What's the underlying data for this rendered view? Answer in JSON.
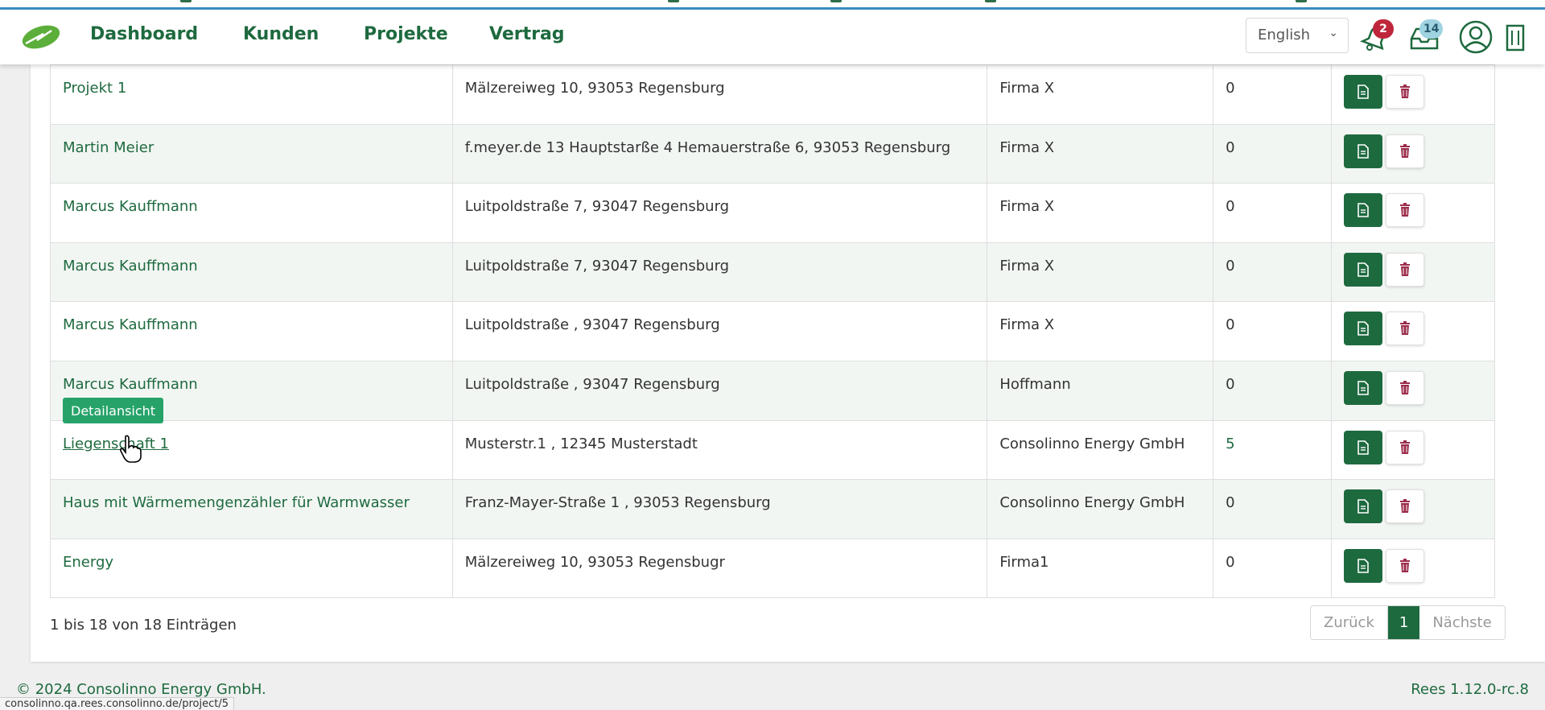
{
  "header": {
    "nav": [
      {
        "label": "Dashboard"
      },
      {
        "label": "Kunden"
      },
      {
        "label": "Projekte"
      },
      {
        "label": "Vertrag"
      }
    ],
    "language": "English",
    "notifications_count": "2",
    "messages_count": "14"
  },
  "table": {
    "rows": [
      {
        "name": "Projekt 1",
        "address": "Mälzereiweg 10, 93053 Regensburg",
        "company": "Firma X",
        "count": "0"
      },
      {
        "name": "Martin Meier",
        "address": "f.meyer.de 13 Hauptstarße 4 Hemauerstraße 6, 93053 Regensburg",
        "company": "Firma X",
        "count": "0"
      },
      {
        "name": "Marcus Kauffmann",
        "address": "Luitpoldstraße 7, 93047 Regensburg",
        "company": "Firma X",
        "count": "0"
      },
      {
        "name": "Marcus Kauffmann",
        "address": "Luitpoldstraße 7, 93047 Regensburg",
        "company": "Firma X",
        "count": "0"
      },
      {
        "name": "Marcus Kauffmann",
        "address": "Luitpoldstraße , 93047 Regensburg",
        "company": "Firma X",
        "count": "0"
      },
      {
        "name": "Marcus Kauffmann",
        "address": "Luitpoldstraße , 93047 Regensburg",
        "company": "Hoffmann",
        "count": "0"
      },
      {
        "name": "Liegenschaft 1",
        "address": "Musterstr.1 , 12345 Musterstadt",
        "company": "Consolinno Energy GmbH",
        "count": "5"
      },
      {
        "name": "Haus mit Wärmemengenzähler für Warmwasser",
        "address": "Franz-Mayer-Straße 1 , 93053 Regensburg",
        "company": "Consolinno Energy GmbH",
        "count": "0"
      },
      {
        "name": "Energy",
        "address": "Mälzereiweg 10, 93053 Regensbugr",
        "company": "Firma1",
        "count": "0"
      }
    ]
  },
  "tooltip": "Detailansicht",
  "pagination": {
    "info": "1 bis 18 von 18 Einträgen",
    "prev": "Zurück",
    "current": "1",
    "next": "Nächste"
  },
  "footer": {
    "copyright": "© 2024 Consolinno Energy GmbH.",
    "version": "Rees 1.12.0-rc.8"
  },
  "status_url": "consolinno.qa.rees.consolinno.de/project/5",
  "colors": {
    "brand_green": "#1e6a3f",
    "tooltip_green": "#27a36a",
    "badge_red": "#c0263b",
    "badge_blue": "#9fd3e0"
  }
}
